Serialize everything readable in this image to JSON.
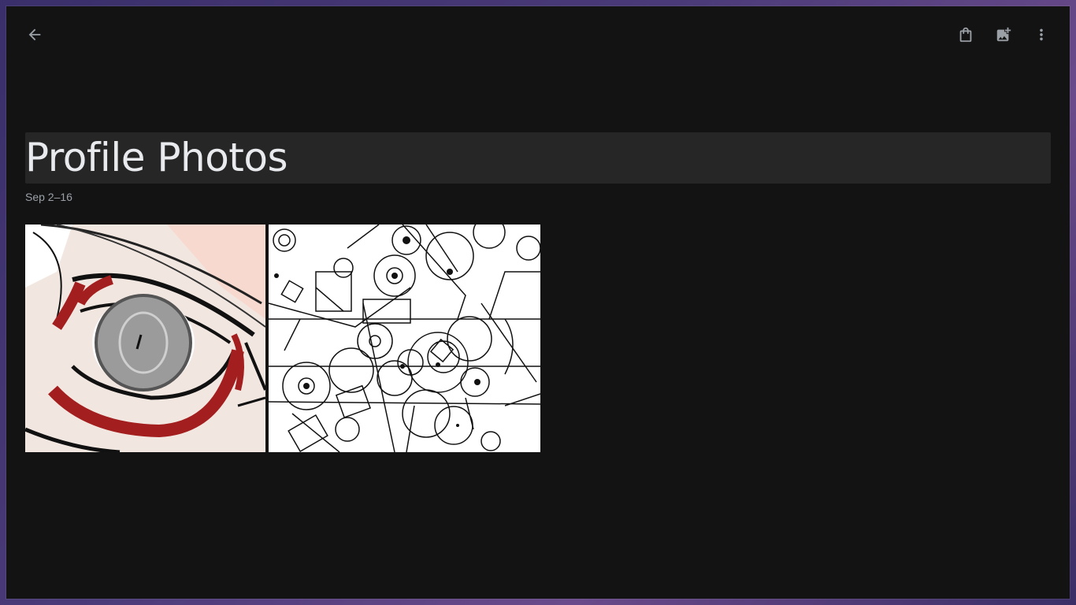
{
  "album": {
    "title": "Profile Photos",
    "date_range": "Sep 2–16"
  },
  "toolbar": {
    "back_icon": "arrow-back-icon",
    "bag_icon": "shopping-bag-icon",
    "add_photo_icon": "add-photo-icon",
    "more_icon": "more-vert-icon"
  },
  "photos": [
    {
      "subject": "anime-eye-sketch",
      "kind": "illustration"
    },
    {
      "subject": "geometric-circles-drawing",
      "kind": "illustration"
    }
  ],
  "colors": {
    "background": "#131314",
    "title_bg": "#262627",
    "title_text": "#e8eaed",
    "secondary_text": "#9aa0a6"
  }
}
